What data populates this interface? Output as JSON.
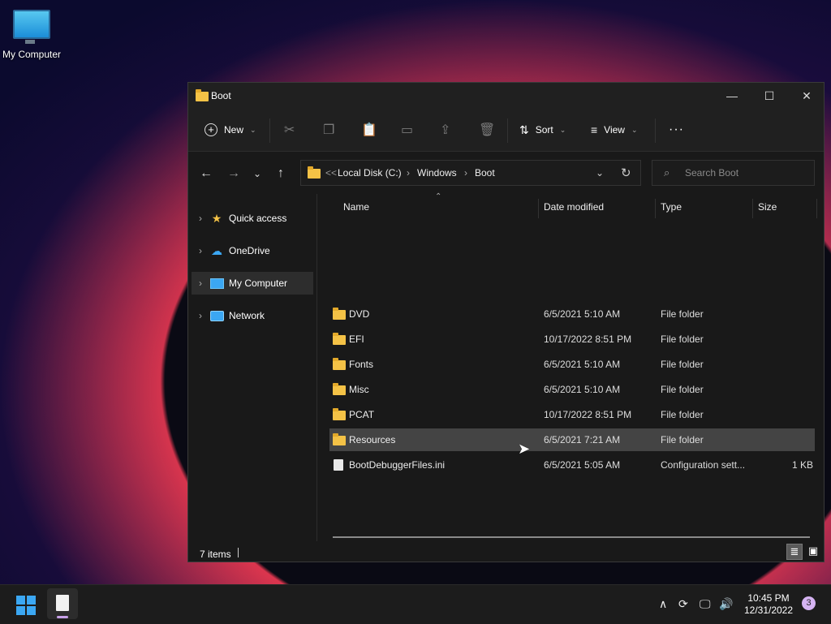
{
  "desktop": {
    "icon_label": "My Computer"
  },
  "window": {
    "title": "Boot",
    "controls": {
      "minimize": "—",
      "maximize": "☐",
      "close": "✕"
    }
  },
  "toolbar": {
    "new_label": "New",
    "sort_label": "Sort",
    "view_label": "View",
    "more_label": "···"
  },
  "address": {
    "overflow": "<<",
    "crumbs": [
      "Local Disk (C:)",
      "Windows",
      "Boot"
    ]
  },
  "search": {
    "placeholder": "Search Boot"
  },
  "sidebar": {
    "items": [
      {
        "label": "Quick access",
        "icon": "star-icon"
      },
      {
        "label": "OneDrive",
        "icon": "cloud-icon"
      },
      {
        "label": "My Computer",
        "icon": "computer-icon",
        "selected": true
      },
      {
        "label": "Network",
        "icon": "network-icon"
      }
    ]
  },
  "columns": {
    "name": "Name",
    "date": "Date modified",
    "type": "Type",
    "size": "Size"
  },
  "files": [
    {
      "name": "DVD",
      "date": "6/5/2021 5:10 AM",
      "type": "File folder",
      "size": "",
      "kind": "folder"
    },
    {
      "name": "EFI",
      "date": "10/17/2022 8:51 PM",
      "type": "File folder",
      "size": "",
      "kind": "folder"
    },
    {
      "name": "Fonts",
      "date": "6/5/2021 5:10 AM",
      "type": "File folder",
      "size": "",
      "kind": "folder"
    },
    {
      "name": "Misc",
      "date": "6/5/2021 5:10 AM",
      "type": "File folder",
      "size": "",
      "kind": "folder"
    },
    {
      "name": "PCAT",
      "date": "10/17/2022 8:51 PM",
      "type": "File folder",
      "size": "",
      "kind": "folder"
    },
    {
      "name": "Resources",
      "date": "6/5/2021 7:21 AM",
      "type": "File folder",
      "size": "",
      "kind": "folder",
      "selected": true
    },
    {
      "name": "BootDebuggerFiles.ini",
      "date": "6/5/2021 5:05 AM",
      "type": "Configuration sett...",
      "size": "1 KB",
      "kind": "file"
    }
  ],
  "status": {
    "items_count": "7 items"
  },
  "taskbar": {
    "time": "10:45 PM",
    "date": "12/31/2022",
    "notification_count": "3"
  },
  "colors": {
    "accent": "#3ba7f3",
    "selection": "#444444",
    "folder": "#f4c246"
  }
}
